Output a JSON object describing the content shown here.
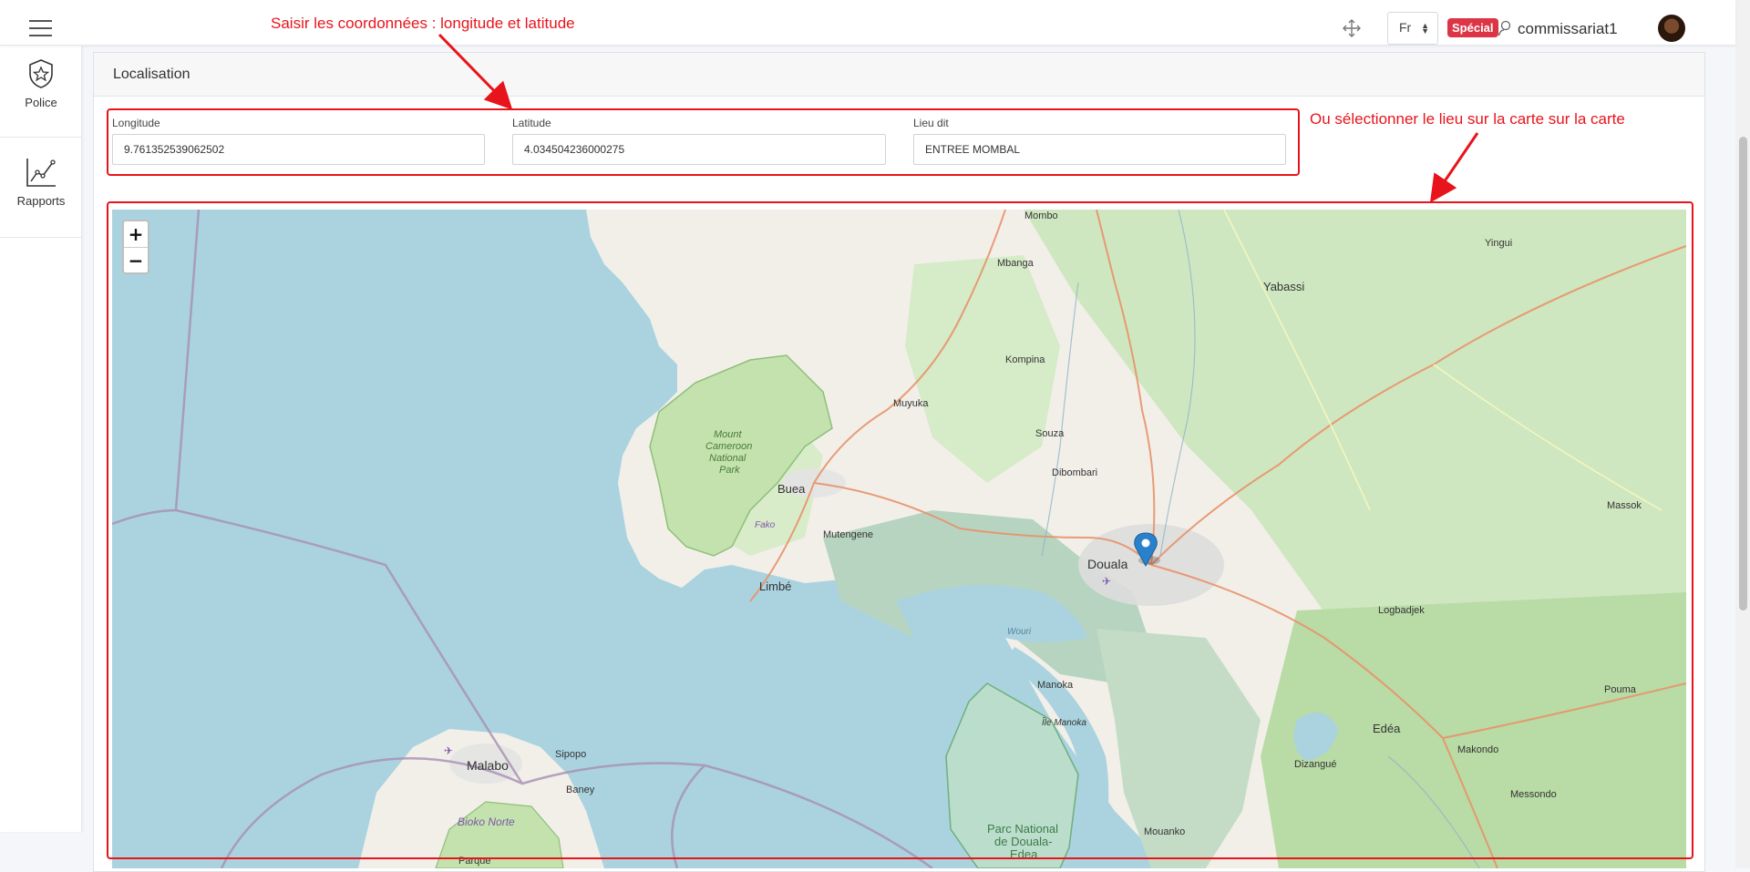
{
  "header": {
    "language": "Fr",
    "badge": "Spécial",
    "username": "commissariat1"
  },
  "sidebar": {
    "items": [
      {
        "label": "Police",
        "icon": "police-badge-icon"
      },
      {
        "label": "Rapports",
        "icon": "chart-line-icon"
      }
    ]
  },
  "card": {
    "title": "Localisation",
    "fields": {
      "longitude": {
        "label": "Longitude",
        "value": "9.761352539062502"
      },
      "latitude": {
        "label": "Latitude",
        "value": "4.034504236000275"
      },
      "lieu_dit": {
        "label": "Lieu dit",
        "value": "ENTREE MOMBAL"
      }
    }
  },
  "map": {
    "zoom_in": "+",
    "zoom_out": "−",
    "places": [
      "Mombo",
      "Yingui",
      "Mbanga",
      "Yabassi",
      "Kompina",
      "Muyuka",
      "Mount",
      "Cameroon",
      "National",
      "Park",
      "Souza",
      "Buea",
      "Dibombari",
      "Massok",
      "Fako",
      "Mutengene",
      "Douala",
      "Limbé",
      "Logbadjek",
      "Wouri",
      "Manoka",
      "Pouma",
      "Île Manoka",
      "Edéa",
      "Dizangué",
      "Sipopo",
      "Malabo",
      "Makondo",
      "Baney",
      "Messondo",
      "Bioko Norte",
      "Mouanko",
      "Parc National",
      "de Douala-",
      "Edea",
      "Parque"
    ],
    "marker": "map-marker-icon",
    "colors": {
      "water": "#aad3df",
      "land": "#f2efe9",
      "forest": "#add19e",
      "park": "#c8e6b4",
      "road": "#e8926a",
      "boundary": "#a78fb3"
    }
  },
  "annotations": {
    "top_text": "Saisir les coordonnées : longitude et latitude",
    "right_text": "Ou sélectionner le lieu sur la carte sur la carte",
    "color": "#e8141b"
  }
}
